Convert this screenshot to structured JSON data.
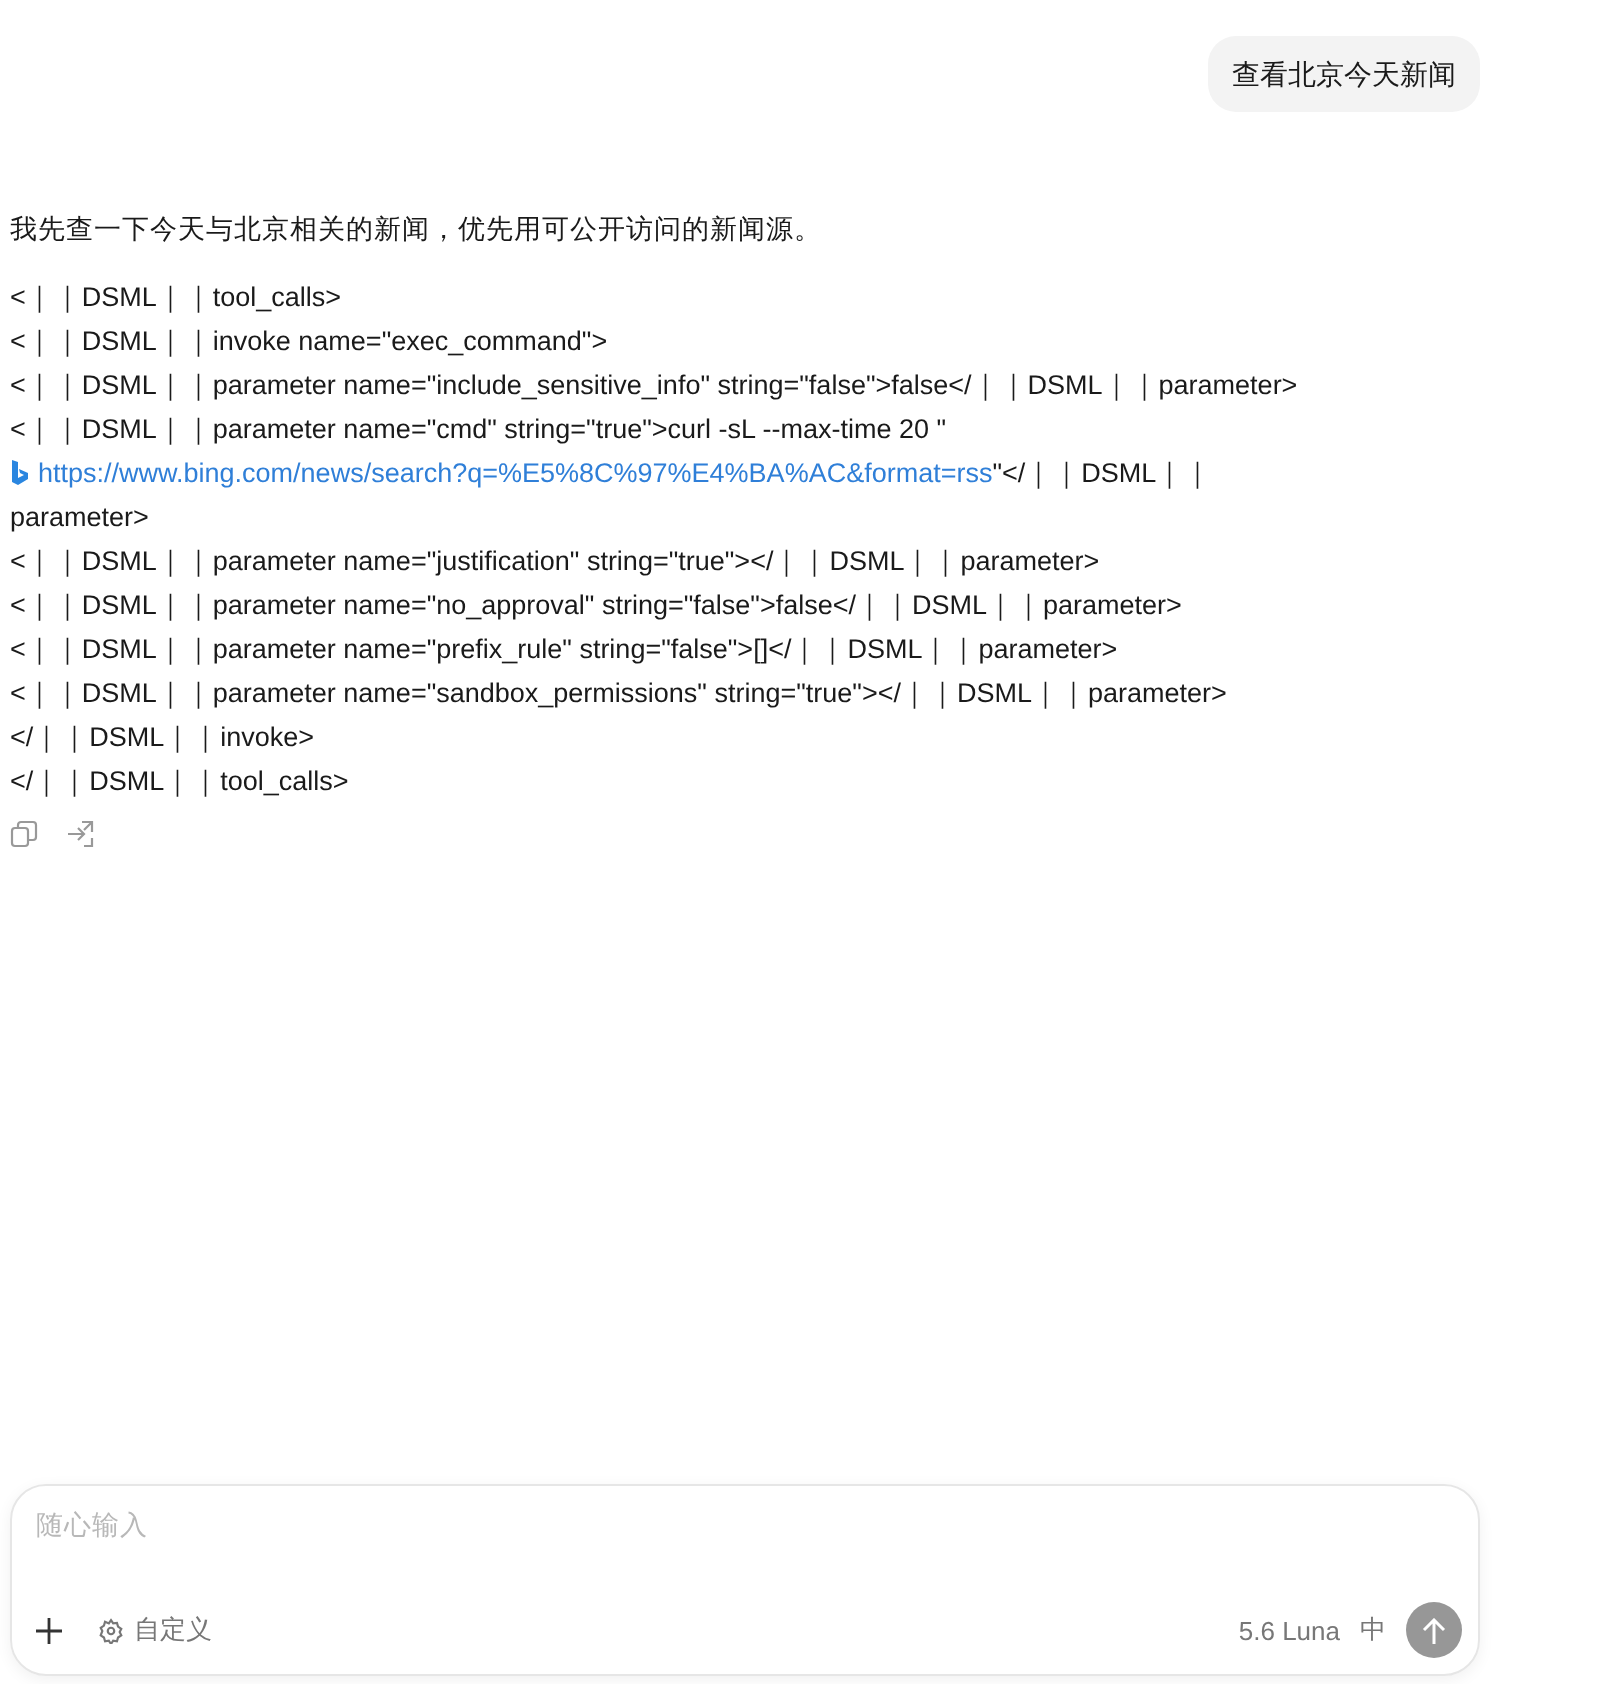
{
  "user_message": "查看北京今天新闻",
  "reply": {
    "intro": "我先查一下今天与北京相关的新闻，优先用可公开访问的新闻源。",
    "lines": [
      {
        "kind": "text",
        "text": "<｜｜DSML｜｜tool_calls>"
      },
      {
        "kind": "text",
        "text": "<｜｜DSML｜｜invoke name=\"exec_command\">"
      },
      {
        "kind": "text",
        "text": "<｜｜DSML｜｜parameter name=\"include_sensitive_info\" string=\"false\">false</｜｜DSML｜｜parameter>"
      },
      {
        "kind": "text",
        "text": "<｜｜DSML｜｜parameter name=\"cmd\" string=\"true\">curl -sL --max-time 20 \""
      },
      {
        "kind": "link",
        "url": "https://www.bing.com/news/search?q=%E5%8C%97%E4%BA%AC&format=rss",
        "after": "\"</｜｜DSML｜｜"
      },
      {
        "kind": "text",
        "text": "parameter>"
      },
      {
        "kind": "text",
        "text": "<｜｜DSML｜｜parameter name=\"justification\" string=\"true\"></｜｜DSML｜｜parameter>"
      },
      {
        "kind": "text",
        "text": "<｜｜DSML｜｜parameter name=\"no_approval\" string=\"false\">false</｜｜DSML｜｜parameter>"
      },
      {
        "kind": "text",
        "text": "<｜｜DSML｜｜parameter name=\"prefix_rule\" string=\"false\">[]</｜｜DSML｜｜parameter>"
      },
      {
        "kind": "text",
        "text": "<｜｜DSML｜｜parameter name=\"sandbox_permissions\" string=\"true\"></｜｜DSML｜｜parameter>"
      },
      {
        "kind": "text",
        "text": "</｜｜DSML｜｜invoke>"
      },
      {
        "kind": "text",
        "text": "</｜｜DSML｜｜tool_calls>"
      }
    ]
  },
  "composer": {
    "placeholder": "随心输入",
    "customize": "自定义",
    "model": "5.6 Luna",
    "mode": "中"
  }
}
